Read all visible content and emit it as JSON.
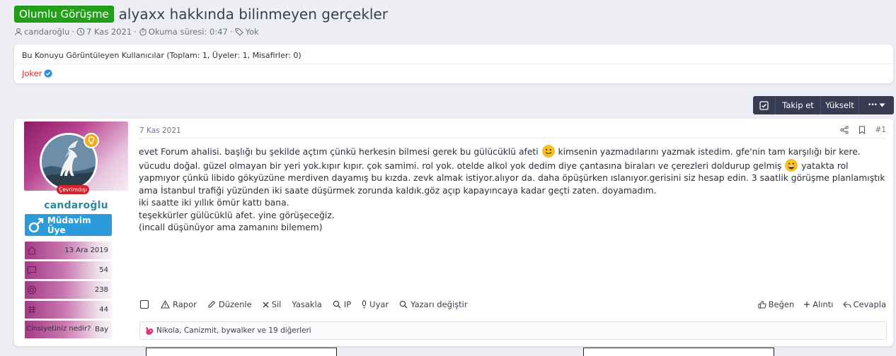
{
  "thread": {
    "prefix": "Olumlu Görüşme",
    "title": "alyaxx hakkında bilinmeyen gerçekler",
    "meta": {
      "author": "candaroğlu",
      "date": "7 Kas 2021",
      "read_time": "Okuma süresi: 0:47",
      "tags": "Yok"
    }
  },
  "viewers": {
    "heading": "Bu Konuyu Görüntüleyen Kullanıcılar (Toplam: 1, Üyeler: 1, Misafirler: 0)",
    "users": [
      "Joker"
    ]
  },
  "toolbar": {
    "follow_label": "Takip et",
    "bump_label": "Yükselt",
    "more_label": "•••"
  },
  "post": {
    "author": {
      "name": "candaroğlu",
      "status": "Çevrimdışı",
      "rank": "Müdavim Üye",
      "stats": {
        "joined": "13 Ara 2019",
        "messages": "54",
        "reactions": "238",
        "points": "44",
        "gender_label": "Cinsiyetiniz nedir?",
        "gender_value": "Bay"
      }
    },
    "date": "7 Kas 2021",
    "number": "#1",
    "body": {
      "line1a": "evet Forum ahalisi. başlığı bu şekilde açtım çünkü herkesin bilmesi gerek bu gülücüklü afeti",
      "line1b": "kimsenin yazmadılarını yazmak istedim. gfe'nin tam karşılığı bir kere.",
      "line2a": "vücudu doğal. güzel olmayan bir yeri yok.kıpır kıpır. çok samimi. rol yok. otelde alkol yok dedim diye çantasına biraları ve çerezleri doldurup gelmiş",
      "line2b": "yatakta rol",
      "line3": "yapmıyor çünkü libido gökyüzüne merdiven dayamış bu kızda. zevk almak istiyor.alıyor da. daha öpüşürken ıslanıyor.gerisini siz hesap edin. 3 saatlik görüşme planlamıştık",
      "line4": "ama İstanbul trafiği yüzünden iki saate düşürmek zorunda kaldık.göz açıp kapayıncaya kadar geçti zaten. doyamadım.",
      "line5": "iki saatte iki yıllık ömür kattı bana.",
      "line6": "teşekkürler gülücüklü afet. yine görüşeceğiz.",
      "line7": "(incall düşünüyor ama zamanını bilemem)"
    },
    "actions": {
      "report": "Rapor",
      "edit": "Düzenle",
      "delete": "Sil",
      "ban": "Yasakla",
      "ip": "IP",
      "warn": "Uyar",
      "change_author": "Yazarı değiştir",
      "like": "Beğen",
      "quote": "Alıntı",
      "reply": "Cevapla"
    },
    "reactions_text": "Nikola, Canizmit, bywalker ve 19 diğerleri"
  },
  "colors": {
    "accent": "#383c52",
    "prefix_green": "#21a018",
    "username_teal": "#2b8a9e",
    "rank_blue": "#2d9ad9",
    "offline_red": "#d4232a",
    "viewer_red": "#d2312c"
  }
}
